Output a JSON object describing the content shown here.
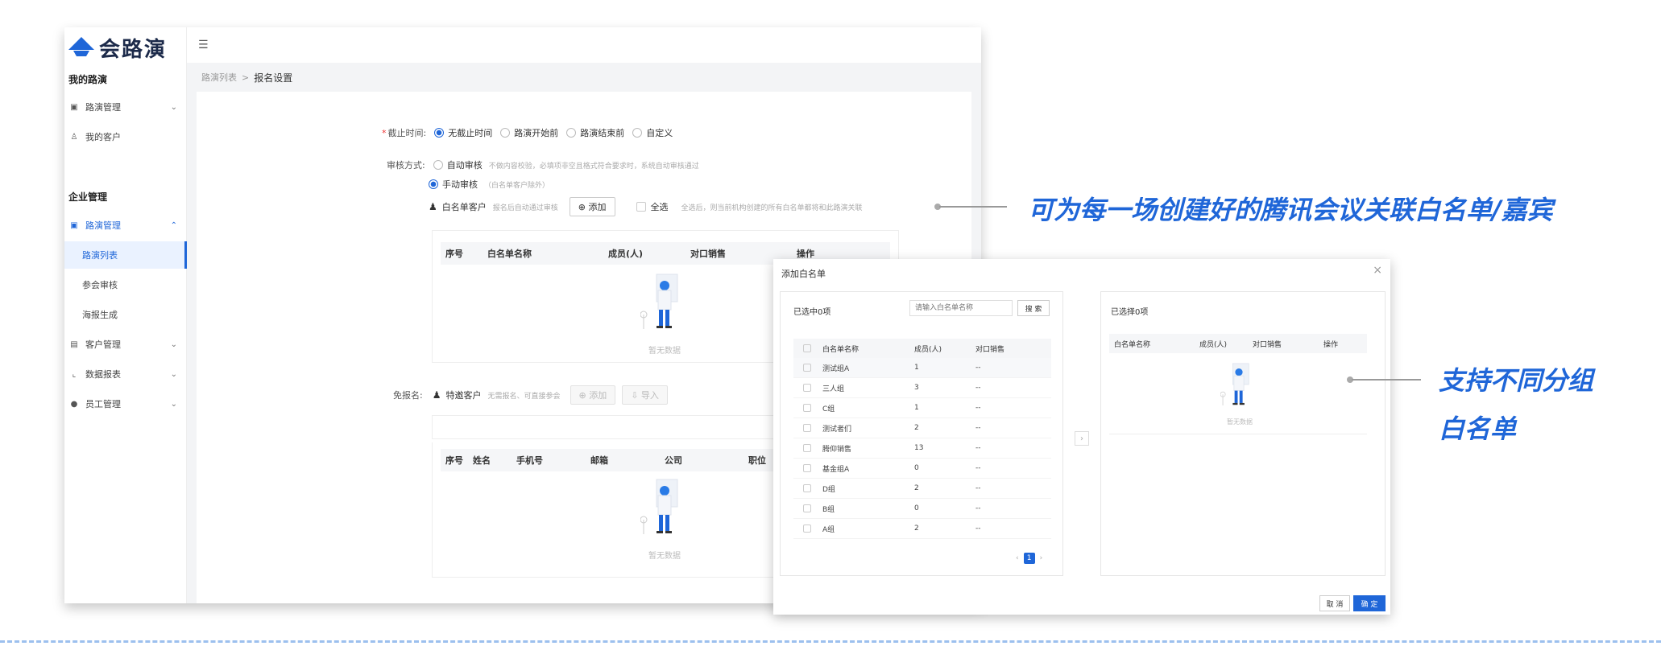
{
  "app": {
    "logo": "会路演"
  },
  "sidebar": {
    "section1": "我的路演",
    "items1": [
      {
        "label": "路演管理",
        "icon": "badge-icon"
      },
      {
        "label": "我的客户",
        "icon": "user-icon"
      }
    ],
    "section2": "企业管理",
    "items2": [
      {
        "label": "路演管理",
        "icon": "badge-icon"
      },
      {
        "label": "路演列表"
      },
      {
        "label": "参会审核"
      },
      {
        "label": "海报生成"
      },
      {
        "label": "客户管理",
        "icon": "contacts-icon"
      },
      {
        "label": "数据报表",
        "icon": "chart-icon"
      },
      {
        "label": "员工管理",
        "icon": "people-icon"
      }
    ]
  },
  "breadcrumb": {
    "parent": "路演列表",
    "sep": ">",
    "current": "报名设置"
  },
  "form": {
    "deadline": {
      "label": "截止时间:",
      "options": [
        "无截止时间",
        "路演开始前",
        "路演结束前",
        "自定义"
      ],
      "selected": "无截止时间"
    },
    "review": {
      "label": "审核方式:",
      "auto": "自动审核",
      "auto_hint": "不做内容校验，必填项非空且格式符合要求时，系统自动审核通过",
      "manual": "手动审核",
      "manual_hint": "（白名单客户除外）",
      "selected": "手动审核"
    },
    "whitelist": {
      "label": "白名单客户",
      "hint": "报名后自动通过审核",
      "add": "⊕ 添加",
      "select_all": "全选",
      "select_all_hint": "全选后，则当前机构创建的所有白名单都将和此路演关联",
      "columns": [
        "序号",
        "白名单名称",
        "成员(人)",
        "对口销售",
        "操作"
      ],
      "empty": "暂无数据"
    },
    "exempt": {
      "label": "免报名:",
      "vip": "特邀客户",
      "hint": "无需报名、可直接参会",
      "add": "⊕ 添加",
      "import": "⇩ 导入",
      "columns": [
        "序号",
        "姓名",
        "手机号",
        "邮箱",
        "公司",
        "职位"
      ],
      "empty": "暂无数据"
    }
  },
  "dialog": {
    "title": "添加白名单",
    "left": {
      "header": "已选中0项",
      "search_placeholder": "请输入白名单名称",
      "search_button": "搜 索",
      "columns": [
        "白名单名称",
        "成员(人)",
        "对口销售"
      ],
      "rows": [
        {
          "name": "测试组A",
          "count": "1",
          "sales": "--"
        },
        {
          "name": "三人组",
          "count": "3",
          "sales": "--"
        },
        {
          "name": "C组",
          "count": "1",
          "sales": "--"
        },
        {
          "name": "测试者们",
          "count": "2",
          "sales": "--"
        },
        {
          "name": "腾仰销售",
          "count": "13",
          "sales": "--"
        },
        {
          "name": "基金组A",
          "count": "0",
          "sales": "--"
        },
        {
          "name": "D组",
          "count": "2",
          "sales": "--"
        },
        {
          "name": "B组",
          "count": "0",
          "sales": "--"
        },
        {
          "name": "A组",
          "count": "2",
          "sales": "--"
        }
      ],
      "page": "1"
    },
    "right": {
      "header": "已选择0项",
      "columns": [
        "白名单名称",
        "成员(人)",
        "对口销售",
        "操作"
      ],
      "empty": "暂无数据"
    },
    "cancel": "取 消",
    "confirm": "确 定"
  },
  "callouts": {
    "top": "可为每一场创建好的腾讯会议关联白名单/嘉宾",
    "right_line1": "支持不同分组",
    "right_line2": "白名单"
  },
  "colors": {
    "accent": "#1f66d8"
  }
}
